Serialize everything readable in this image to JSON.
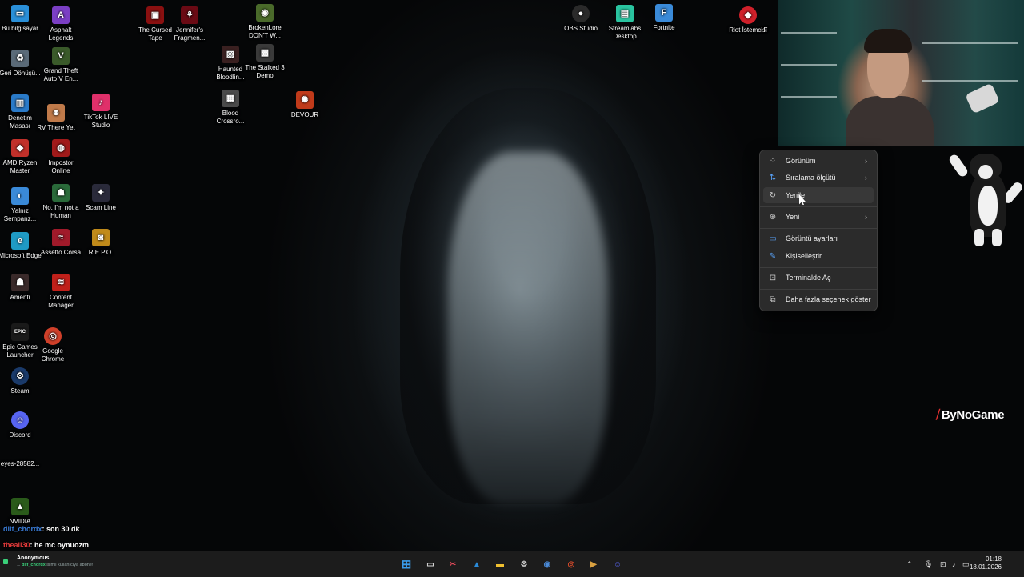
{
  "desktop": {
    "icons": [
      {
        "label": "Bu bilgisayar",
        "glyph": "▭",
        "color": "#2a8fd8"
      },
      {
        "label": "Asphalt Legends",
        "glyph": "A",
        "color": "#7b3fc4"
      },
      {
        "label": "The Cursed Tape",
        "glyph": "▣",
        "color": "#8a1010"
      },
      {
        "label": "Jennifer's Fragmen...",
        "glyph": "⚘",
        "color": "#6a0a14"
      },
      {
        "label": "BrokenLore DON'T W...",
        "glyph": "◉",
        "color": "#4a6a2a"
      },
      {
        "label": "Geri Dönüşü...",
        "glyph": "♻",
        "color": "#5a6a78"
      },
      {
        "label": "Grand Theft Auto V En...",
        "glyph": "V",
        "color": "#3a5a2a"
      },
      {
        "label": "Haunted Bloodlin...",
        "glyph": "▨",
        "color": "#3a2020"
      },
      {
        "label": "The Stalked 3 Demo",
        "glyph": "▩",
        "color": "#3a3a3a"
      },
      {
        "label": "Denetim Masası",
        "glyph": "▥",
        "color": "#2a7ac8"
      },
      {
        "label": "RV There Yet",
        "glyph": "☻",
        "color": "#c07a4a"
      },
      {
        "label": "TikTok LIVE Studio",
        "glyph": "♪",
        "color": "#e0306a"
      },
      {
        "label": "Blood Crossro...",
        "glyph": "▦",
        "color": "#4a4a4a"
      },
      {
        "label": "DEVOUR",
        "glyph": "✺",
        "color": "#c03a1a"
      },
      {
        "label": "AMD Ryzen Master",
        "glyph": "◆",
        "color": "#c0302a"
      },
      {
        "label": "Impostor Online",
        "glyph": "◍",
        "color": "#a01a1a"
      },
      {
        "label": "Yalnız Sempanz...",
        "glyph": "◐",
        "color": "#3a8ad8"
      },
      {
        "label": "No, I'm not a Human",
        "glyph": "☗",
        "color": "#2a6a3a"
      },
      {
        "label": "Scam Line",
        "glyph": "✦",
        "color": "#2a2a3a"
      },
      {
        "label": "Microsoft Edge",
        "glyph": "e",
        "color": "#1f9ac4"
      },
      {
        "label": "Assetto Corsa",
        "glyph": "≈",
        "color": "#a01a2a"
      },
      {
        "label": "R.E.P.O.",
        "glyph": "◙",
        "color": "#c08a1a"
      },
      {
        "label": "Amenti",
        "glyph": "☗",
        "color": "#3a2a2a"
      },
      {
        "label": "Content Manager",
        "glyph": "≋",
        "color": "#c0201a"
      },
      {
        "label": "Epic Games Launcher",
        "glyph": "EPIC",
        "color": "#1a1a1a"
      },
      {
        "label": "Google Chrome",
        "glyph": "◎",
        "color": "#d0402a"
      },
      {
        "label": "Steam",
        "glyph": "⚙",
        "color": "#1a3a6a"
      },
      {
        "label": "Discord",
        "glyph": "☺",
        "color": "#5865f2"
      },
      {
        "label": "eyes-28582...",
        "glyph": "",
        "color": "#050607"
      },
      {
        "label": "NVIDIA",
        "glyph": "▲",
        "color": "#2a5a1a"
      },
      {
        "label": "OBS Studio",
        "glyph": "●",
        "color": "#2a2a2a"
      },
      {
        "label": "Streamlabs Desktop",
        "glyph": "▤",
        "color": "#2ac4a0"
      },
      {
        "label": "Fortnite",
        "glyph": "F",
        "color": "#3a8ad8"
      },
      {
        "label": "Riot İstemcisi",
        "glyph": "◆",
        "color": "#d0202a"
      },
      {
        "label": "F",
        "glyph": "",
        "color": "#050607"
      }
    ]
  },
  "context_menu": {
    "items": [
      {
        "label": "Görünüm",
        "icon": "grid-icon",
        "glyph": "⁘",
        "submenu": true
      },
      {
        "label": "Sıralama ölçütü",
        "icon": "sort-icon",
        "glyph": "⇅",
        "submenu": true
      },
      {
        "label": "Yenile",
        "icon": "refresh-icon",
        "glyph": "↻",
        "submenu": false
      },
      {
        "label": "Yeni",
        "icon": "new-icon",
        "glyph": "⊕",
        "submenu": true
      },
      {
        "label": "Görüntü ayarları",
        "icon": "display-icon",
        "glyph": "▭",
        "submenu": false
      },
      {
        "label": "Kişiselleştir",
        "icon": "pen-icon",
        "glyph": "✎",
        "submenu": false
      },
      {
        "label": "Terminalde Aç",
        "icon": "terminal-icon",
        "glyph": "⊡",
        "submenu": false
      },
      {
        "label": "Daha fazla seçenek göster",
        "icon": "more-options-icon",
        "glyph": "⧉",
        "submenu": false
      }
    ]
  },
  "overlay": {
    "brand": "ByNoGame",
    "chat": [
      {
        "user": "dilf_chordx",
        "message": ": son 30 dk"
      },
      {
        "user": "theali30",
        "message": ": he mc oynuozm"
      }
    ]
  },
  "taskbar": {
    "notification": {
      "name": "Anonymous",
      "rank": "1.",
      "user": "dilf_chordx",
      "text": "isimli kullanıcıya abone!"
    },
    "apps": [
      {
        "name": "start-icon",
        "glyph": "⊞",
        "color": "#3a9ae8"
      },
      {
        "name": "task-view-icon",
        "glyph": "▭",
        "color": "#d8d8d8"
      },
      {
        "name": "snipping-tool-icon",
        "glyph": "✂",
        "color": "#e04a5a"
      },
      {
        "name": "photos-icon",
        "glyph": "▲",
        "color": "#2a8ad8"
      },
      {
        "name": "file-explorer-icon",
        "glyph": "▬",
        "color": "#f0c030"
      },
      {
        "name": "app-icon",
        "glyph": "⚙",
        "color": "#d0d0d0"
      },
      {
        "name": "steam-icon",
        "glyph": "◉",
        "color": "#2a5a9a"
      },
      {
        "name": "chrome-icon",
        "glyph": "◎",
        "color": "#d84a2a"
      },
      {
        "name": "media-icon",
        "glyph": "▶",
        "color": "#d8a040"
      },
      {
        "name": "discord-icon",
        "glyph": "☺",
        "color": "#5865f2"
      }
    ],
    "tray": {
      "chevron": "⌃",
      "mic": "🎙",
      "network": "⊡",
      "volume": "♪",
      "battery": "▭"
    },
    "time": "01:18",
    "date": "18.01.2026"
  }
}
